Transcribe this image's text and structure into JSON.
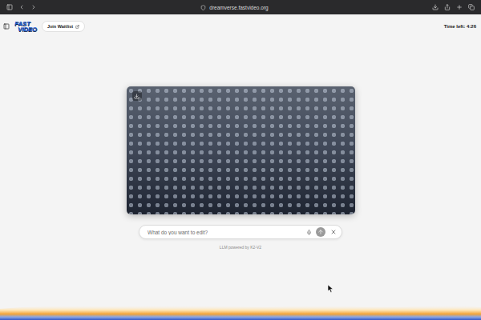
{
  "browser": {
    "url": "dreamverse.fastvideo.org"
  },
  "header": {
    "logo": [
      "FAST",
      "VIDEO"
    ],
    "waitlist_button": "Join Waitlist",
    "timer": "Time left: 4:26"
  },
  "prompt": {
    "placeholder": "What do you want to edit?"
  },
  "footer": {
    "credit": "LLM powered by K2-V2"
  }
}
